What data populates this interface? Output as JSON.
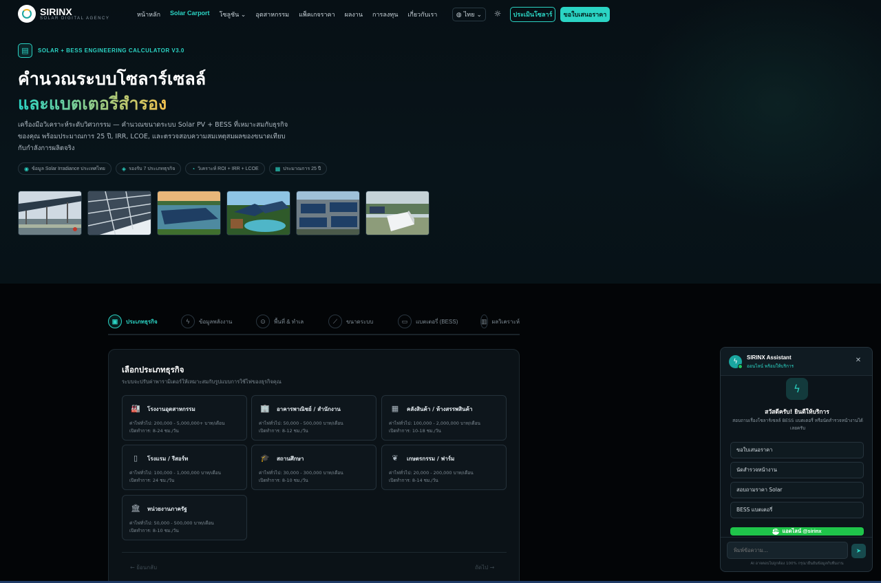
{
  "nav": {
    "logo_name": "SIRINX",
    "logo_sub": "SOLAR DIGITAL AGENCY",
    "menu": [
      "หน้าหลัก",
      "Solar Carport",
      "โซลูชัน ⌄",
      "อุตสาหกรรม",
      "แพ็คเกจราคา",
      "ผลงาน",
      "การลงทุน",
      "เกี่ยวกับเรา"
    ],
    "lang": "ไทย",
    "assess_button": "ประเมินโซลาร์",
    "quote_button": "ขอใบเสนอราคา"
  },
  "hero": {
    "tagline": "SOLAR + BESS ENGINEERING CALCULATOR V3.0",
    "title_line1": "คำนวณระบบโซลาร์เซลล์",
    "title_line2": "และแบตเตอรี่สำรอง",
    "description": "เครื่องมือวิเคราะห์ระดับวิศวกรรม — คำนวณขนาดระบบ Solar PV + BESS ที่เหมาะสมกับธุรกิจของคุณ พร้อมประมาณการ 25 ปี, IRR, LCOE, และตรวจสอบความสมเหตุสมผลของขนาดเทียบกับกำลังการผลิตจริง",
    "chips": [
      "ข้อมูล Solar Irradiance ประเทศไทย",
      "รองรับ 7 ประเภทธุรกิจ",
      "วิเคราะห์ ROI + IRR + LCOE",
      "ประมาณการ 25 ปี"
    ]
  },
  "tabs": [
    "ประเภทธุรกิจ",
    "ข้อมูลพลังงาน",
    "พื้นที่ & ทำเล",
    "ขนาดระบบ",
    "แบตเตอรี่ (BESS)",
    "ผลวิเคราะห์"
  ],
  "card": {
    "title": "เลือกประเภทธุรกิจ",
    "subtitle": "ระบบจะปรับค่าพารามิเตอร์ให้เหมาะสมกับรูปแบบการใช้ไฟของธุรกิจคุณ",
    "businesses": [
      {
        "name": "โรงงานอุตสาหกรรม",
        "bill": "ค่าไฟทั่วไป: 200,000 - 5,000,000+ บาท/เดือน",
        "hours": "เปิดทำการ: 8-24 ชม./วัน",
        "icon": "factory-icon",
        "glyph": "🏭"
      },
      {
        "name": "อาคารพาณิชย์ / สำนักงาน",
        "bill": "ค่าไฟทั่วไป: 50,000 - 500,000 บาท/เดือน",
        "hours": "เปิดทำการ: 8-12 ชม./วัน",
        "icon": "building-icon",
        "glyph": "🏢"
      },
      {
        "name": "คลังสินค้า / ห้างสรรพสินค้า",
        "bill": "ค่าไฟทั่วไป: 100,000 - 2,000,000 บาท/เดือน",
        "hours": "เปิดทำการ: 10-18 ชม./วัน",
        "icon": "warehouse-icon",
        "glyph": "▦"
      },
      {
        "name": "โรงแรม / รีสอร์ท",
        "bill": "ค่าไฟทั่วไป: 100,000 - 1,000,000 บาท/เดือน",
        "hours": "เปิดทำการ: 24 ชม./วัน",
        "icon": "hotel-icon",
        "glyph": "▯"
      },
      {
        "name": "สถานศึกษา",
        "bill": "ค่าไฟทั่วไป: 30,000 - 300,000 บาท/เดือน",
        "hours": "เปิดทำการ: 8-10 ชม./วัน",
        "icon": "graduation-cap-icon",
        "glyph": "🎓"
      },
      {
        "name": "เกษตรกรรม / ฟาร์ม",
        "bill": "ค่าไฟทั่วไป: 20,000 - 200,000 บาท/เดือน",
        "hours": "เปิดทำการ: 8-14 ชม./วัน",
        "icon": "leaf-icon",
        "glyph": "❦"
      },
      {
        "name": "หน่วยงานภาครัฐ",
        "bill": "ค่าไฟทั่วไป: 50,000 - 500,000 บาท/เดือน",
        "hours": "เปิดทำการ: 8-10 ชม./วัน",
        "icon": "government-icon",
        "glyph": "🏛"
      }
    ],
    "prev": "← ย้อนกลับ",
    "next": "ถัดไป →"
  },
  "chat": {
    "title": "SIRINX Assistant",
    "status": "ออนไลน์ พร้อมให้บริการ",
    "greeting": "สวัสดีครับ! ยินดีให้บริการ",
    "intro": "สอบถามเรื่องโซลาร์เซลล์ BESS แบตเตอรี่ หรือนัดสำรวจหน้างานได้เลยครับ",
    "quick_replies": [
      "ขอใบเสนอราคา",
      "นัดสำรวจหน้างาน",
      "สอบถามราคา Solar",
      "BESS แบตเตอรี่"
    ],
    "line_button": "แอดไลน์ @sirinx",
    "input_placeholder": "พิมพ์ข้อความ...",
    "footer": "AI อาจตอบไม่ถูกต้อง 100% กรุณายืนยันข้อมูลกับทีมงาน"
  },
  "colors": {
    "accent": "#2bd4c4",
    "gold": "#f2c14e",
    "line_green": "#1fc44a",
    "background": "#05080b"
  }
}
